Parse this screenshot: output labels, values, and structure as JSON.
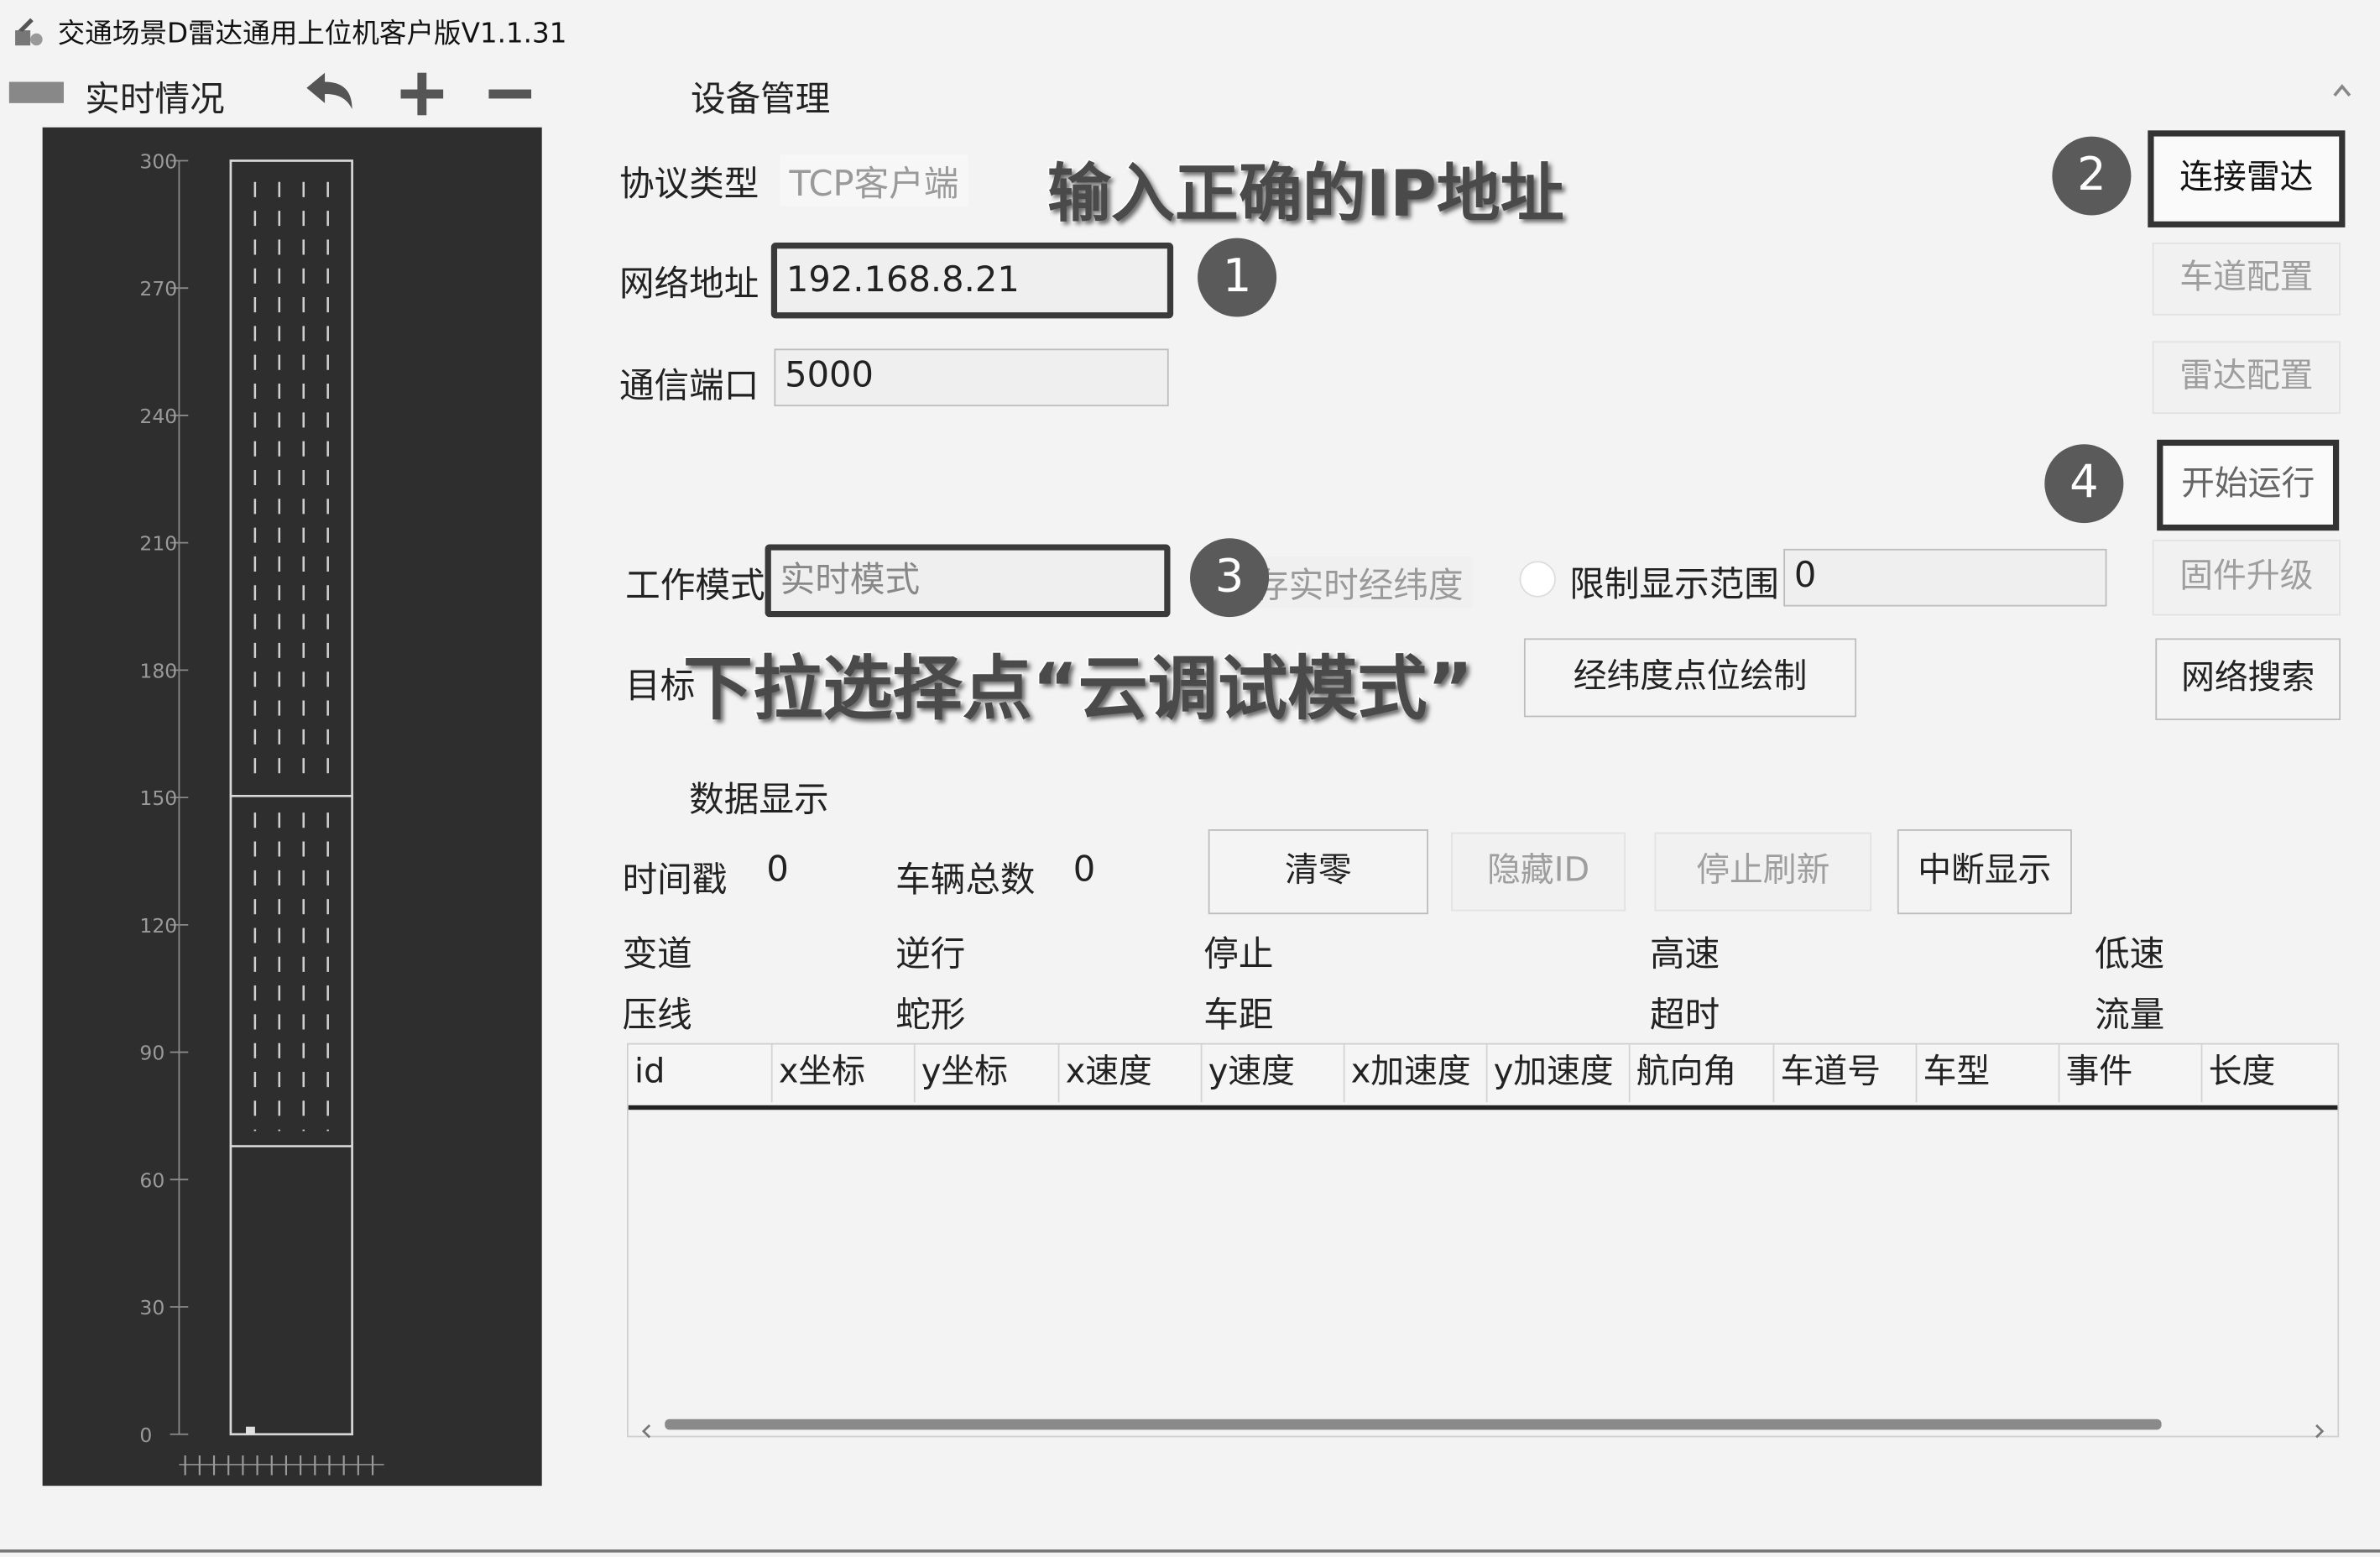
{
  "window": {
    "title": "交通场景D雷达通用上位机客户版V1.1.31"
  },
  "left_panel": {
    "title": "实时情况",
    "icons": [
      "panel-icon",
      "undo-icon",
      "plus-icon",
      "minus-icon"
    ],
    "y_ticks": [
      "300",
      "270",
      "240",
      "210",
      "180",
      "150",
      "120",
      "90",
      "60",
      "30",
      "0"
    ]
  },
  "device": {
    "section_title": "设备管理",
    "protocol_label": "协议类型",
    "protocol_value": "TCP客户端",
    "network_label": "网络地址",
    "network_value": "192.168.8.21",
    "port_label": "通信端口",
    "port_value": "5000",
    "mode_label": "工作模式",
    "mode_value": "实时模式",
    "save_latlon_text": "存实时经纬度",
    "limit_label": "限制显示范围",
    "limit_value": "0",
    "target_label": "目标",
    "latlon_plot_button": "经纬度点位绘制"
  },
  "side_buttons": {
    "connect": "连接雷达",
    "lane_config": "车道配置",
    "radar_config": "雷达配置",
    "start_run": "开始运行",
    "firmware": "固件升级",
    "network_search": "网络搜索"
  },
  "annotations": {
    "ip_tip": "输入正确的IP地址",
    "mode_tip": "下拉选择点“云调试模式”",
    "badges": [
      "1",
      "2",
      "3",
      "4"
    ]
  },
  "data_display": {
    "section_title": "数据显示",
    "timestamp_label": "时间戳",
    "timestamp_value": "0",
    "vehicle_total_label": "车辆总数",
    "vehicle_total_value": "0",
    "clear_button": "清零",
    "hide_id_button": "隐藏ID",
    "stop_refresh_button": "停止刷新",
    "interrupt_button": "中断显示",
    "events_row1": [
      "变道",
      "逆行",
      "停止",
      "高速",
      "低速"
    ],
    "events_row2": [
      "压线",
      "蛇形",
      "车距",
      "超时",
      "流量"
    ],
    "table_headers": [
      "id",
      "x坐标",
      "y坐标",
      "x速度",
      "y速度",
      "x加速度",
      "y加速度",
      "航向角",
      "车道号",
      "车型",
      "事件",
      "长度"
    ]
  },
  "colors": {
    "chart_bg": "#2e2e2e",
    "badge": "#5a5a5a",
    "highlight_border": "#333333"
  }
}
